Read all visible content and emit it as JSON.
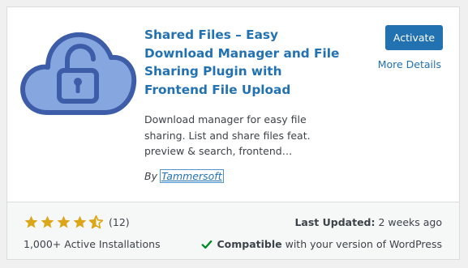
{
  "plugin": {
    "title": "Shared Files – Easy Download Manager and File Sharing Plugin with Frontend File Upload",
    "description": "Download manager for easy file sharing. List and share files feat. preview & search, frontend…",
    "author_prefix": "By",
    "author_name": "Tammersoft",
    "icon": "cloud-lock-icon"
  },
  "actions": {
    "activate_label": "Activate",
    "more_details_label": "More Details"
  },
  "footer": {
    "rating": 4.5,
    "rating_max": 5,
    "rating_count": "(12)",
    "installs": "1,000+ Active Installations",
    "last_updated_label": "Last Updated:",
    "last_updated_value": "2 weeks ago",
    "compat_bold": "Compatible",
    "compat_rest": "with your version of WordPress"
  },
  "colors": {
    "accent": "#2271b1",
    "star": "#dba617",
    "check": "#008a20",
    "icon_fill": "#86a6df",
    "icon_stroke": "#3e5da8"
  }
}
